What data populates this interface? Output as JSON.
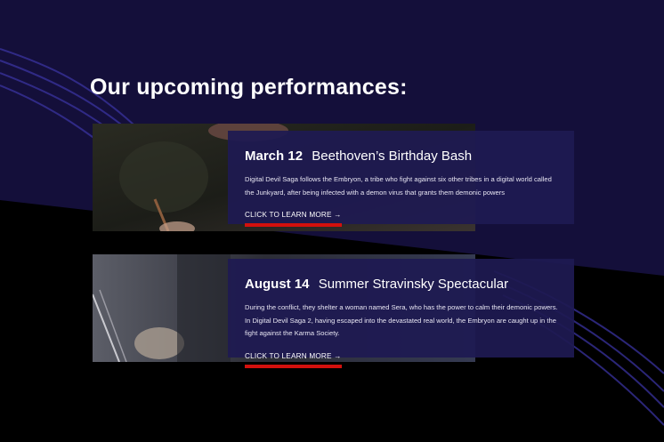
{
  "heading": "Our upcoming performances:",
  "colors": {
    "background_top": "#140f3a",
    "background_bottom": "#000000",
    "card": "#1e1a52",
    "link_underline": "#d3100d"
  },
  "performances": [
    {
      "date": "March 12",
      "title": "Beethoven’s Birthday Bash",
      "description": "Digital Devil Saga follows the Embryon, a tribe who fight against six other tribes in a digital world called the Junkyard, after being infected with a demon virus that grants them demonic powers",
      "link": "CLICK TO LEARN MORE →"
    },
    {
      "date": "August 14",
      "title": "Summer Stravinsky Spectacular",
      "description": "During the conflict, they shelter a woman named Sera, who has the power to calm their demonic powers. In Digital Devil Saga 2, having escaped into the devastated real world, the Embryon are caught up in the fight against the Karma Society.",
      "link": "CLICK TO LEARN MORE →"
    }
  ]
}
